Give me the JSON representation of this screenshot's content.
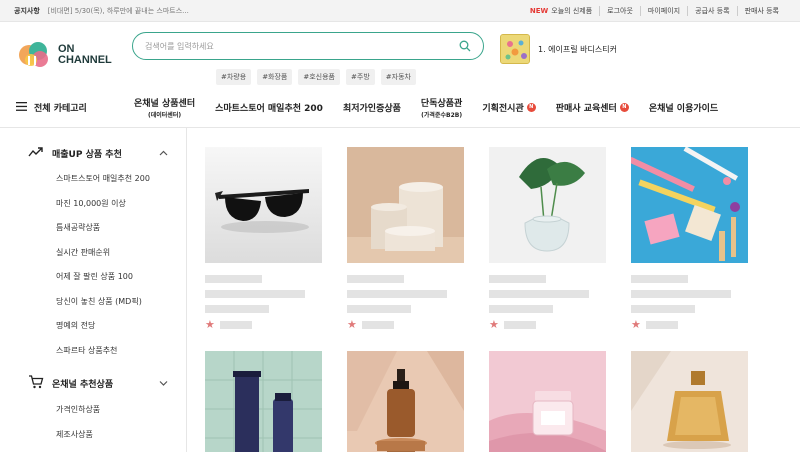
{
  "topbar": {
    "notice_title": "공지사항",
    "notice_text": "[비대면] 5/30(목), 하루만에 끝내는 스마트스...",
    "links": [
      {
        "label": "오늘의 신제품",
        "badge": "NEW"
      },
      {
        "label": "로그아웃",
        "badge": ""
      },
      {
        "label": "마이페이지",
        "badge": ""
      },
      {
        "label": "공급사 등록",
        "badge": ""
      },
      {
        "label": "판매사 등록",
        "badge": ""
      }
    ]
  },
  "logo": {
    "line1": "ON",
    "line2": "CHANNEL"
  },
  "search": {
    "placeholder": "검색어를 입력하세요",
    "tags": [
      "#차량용",
      "#화장품",
      "#호신용품",
      "#주방",
      "#자동차"
    ]
  },
  "ranking": {
    "text": "1. 에이프릴 바디스티커"
  },
  "nav": {
    "all_categories": "전체 카테고리",
    "items": [
      {
        "label": "온채널 상품센터",
        "sub": "(데이터센터)",
        "badge": ""
      },
      {
        "label": "스마트스토어 매일추천 200",
        "sub": "",
        "badge": ""
      },
      {
        "label": "최저가인증상품",
        "sub": "",
        "badge": ""
      },
      {
        "label": "단독상품관",
        "sub": "(가격준수B2B)",
        "badge": ""
      },
      {
        "label": "기획전시관",
        "sub": "",
        "badge": "N"
      },
      {
        "label": "판매사 교육센터",
        "sub": "",
        "badge": "N"
      },
      {
        "label": "온채널 이용가이드",
        "sub": "",
        "badge": ""
      }
    ]
  },
  "sidebar": {
    "sections": [
      {
        "title": "매출UP 상품 추천",
        "items": [
          "스마트스토어 매일추천 200",
          "마진 10,000원 이상",
          "틈새공략상품",
          "실시간 판매순위",
          "어제 잘 팔린 상품 100",
          "당신이 놓친 상품 (MD픽)",
          "명예의 전당",
          "스파르타 상품추천"
        ]
      },
      {
        "title": "온채널 추천상품",
        "items": [
          "가격인하상품",
          "제조사상품"
        ]
      }
    ]
  },
  "colors": {
    "accent": "#3aa58c",
    "badge": "#e74c3c",
    "star": "#e07a7a"
  },
  "products": [
    {
      "image": "sunglasses"
    },
    {
      "image": "pedestals"
    },
    {
      "image": "plant-vase"
    },
    {
      "image": "toothbrushes"
    },
    {
      "image": "cosmetic-tubes"
    },
    {
      "image": "dropper-bottle"
    },
    {
      "image": "cream-jar"
    },
    {
      "image": "perfume"
    }
  ]
}
